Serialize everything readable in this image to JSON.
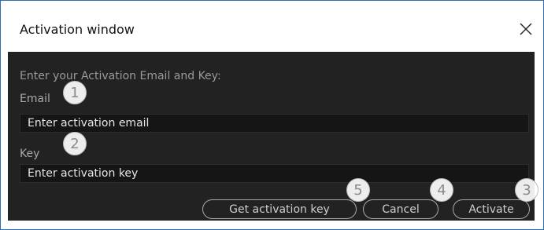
{
  "dialog": {
    "title": "Activation window",
    "instruction": "Enter your Activation Email and Key:",
    "email_label": "Email",
    "email_placeholder": "Enter activation email",
    "key_label": "Key",
    "key_placeholder": "Enter activation key",
    "buttons": {
      "get_key": "Get activation key",
      "cancel": "Cancel",
      "activate": "Activate"
    }
  },
  "callouts": [
    "1",
    "2",
    "3",
    "4",
    "5"
  ],
  "icons": {
    "close": "close-icon"
  },
  "colors": {
    "titlebar_bg": "#ffffff",
    "content_bg": "#222222",
    "field_bg": "#151515",
    "text_muted": "#9a9a9a",
    "window_border": "#2d6fb0"
  }
}
